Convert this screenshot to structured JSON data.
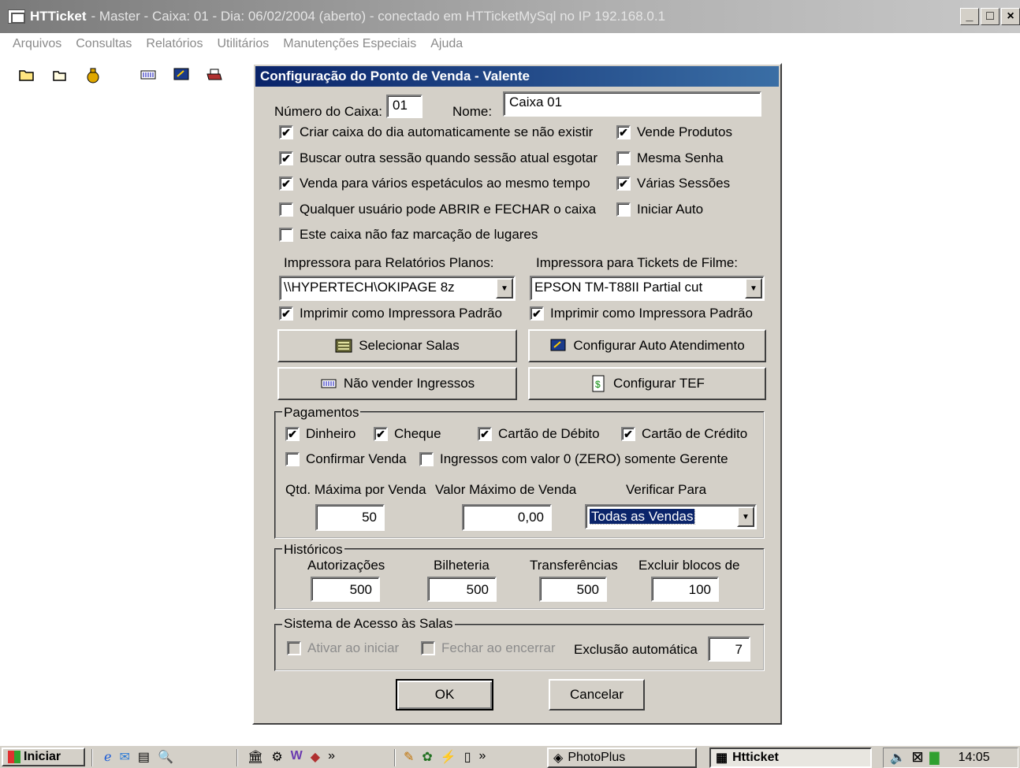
{
  "window": {
    "app": "HTTicket",
    "title_rest": "- Master - Caixa: 01 - Dia: 06/02/2004 (aberto) - conectado em HTTicketMySql no IP 192.168.0.1",
    "buttons": [
      "_",
      "□",
      "×"
    ]
  },
  "menu": [
    "Arquivos",
    "Consultas",
    "Relatórios",
    "Utilitários",
    "Manutenções Especiais",
    "Ajuda"
  ],
  "toolbar": {
    "icons": [
      "open-folder-icon",
      "folder-icon",
      "money-bag-icon",
      "ticket-icon",
      "monitor-icon",
      "printer-icon"
    ]
  },
  "dialog": {
    "title": "Configuração do Ponto de Venda - Valente",
    "numero_label": "Número do Caixa:",
    "numero_value": "01",
    "nome_label": "Nome:",
    "nome_value": "Caixa 01",
    "checks_left": [
      {
        "label": "Criar caixa do dia automaticamente se não existir",
        "checked": true
      },
      {
        "label": "Buscar outra sessão quando sessão atual esgotar",
        "checked": true
      },
      {
        "label": "Venda para vários espetáculos ao mesmo tempo",
        "checked": true
      },
      {
        "label": "Qualquer usuário pode ABRIR e FECHAR o caixa",
        "checked": false
      },
      {
        "label": "Este caixa não faz marcação de lugares",
        "checked": false
      }
    ],
    "checks_right": [
      {
        "label": "Vende Produtos",
        "checked": true
      },
      {
        "label": "Mesma Senha",
        "checked": false
      },
      {
        "label": "Várias Sessões",
        "checked": true
      },
      {
        "label": "Iniciar Auto",
        "checked": false
      }
    ],
    "printer_reports_label": "Impressora para Relatórios Planos:",
    "printer_reports_value": "\\\\HYPERTECH\\OKIPAGE 8z",
    "printer_tickets_label": "Impressora para Tickets de Filme:",
    "printer_tickets_value": "EPSON TM-T88II Partial cut",
    "default_printer_label": "Imprimir como Impressora Padrão",
    "default_printer_reports_checked": true,
    "default_printer_tickets_checked": true,
    "btn_selecionar_salas": "Selecionar Salas",
    "btn_auto_atendimento": "Configurar Auto Atendimento",
    "btn_nao_vender": "Não vender Ingressos",
    "btn_tef": "Configurar TEF",
    "pagamentos": {
      "label": "Pagamentos",
      "dinheiro": "Dinheiro",
      "cheque": "Cheque",
      "debito": "Cartão de Débito",
      "credito": "Cartão de Crédito",
      "confirmar": "Confirmar Venda",
      "zero": "Ingressos com valor 0 (ZERO) somente Gerente",
      "qtd_label": "Qtd. Máxima por Venda",
      "qtd_value": "50",
      "valor_label": "Valor Máximo de Venda",
      "valor_value": "0,00",
      "verificar_label": "Verificar Para",
      "verificar_value": "Todas as Vendas"
    },
    "historicos": {
      "label": "Históricos",
      "autorizacoes_label": "Autorizações",
      "autorizacoes_value": "500",
      "bilheteria_label": "Bilheteria",
      "bilheteria_value": "500",
      "transferencias_label": "Transferências",
      "transferencias_value": "500",
      "excluir_label": "Excluir blocos de",
      "excluir_value": "100"
    },
    "acesso": {
      "label": "Sistema de Acesso às Salas",
      "ativar": "Ativar ao iniciar",
      "fechar": "Fechar ao encerrar",
      "exclusao_label": "Exclusão automática",
      "exclusao_value": "7"
    },
    "ok": "OK",
    "cancelar": "Cancelar"
  },
  "taskbar": {
    "start": "Iniciar",
    "task1": "PhotoPlus",
    "task2": "Htticket",
    "clock": "14:05"
  }
}
